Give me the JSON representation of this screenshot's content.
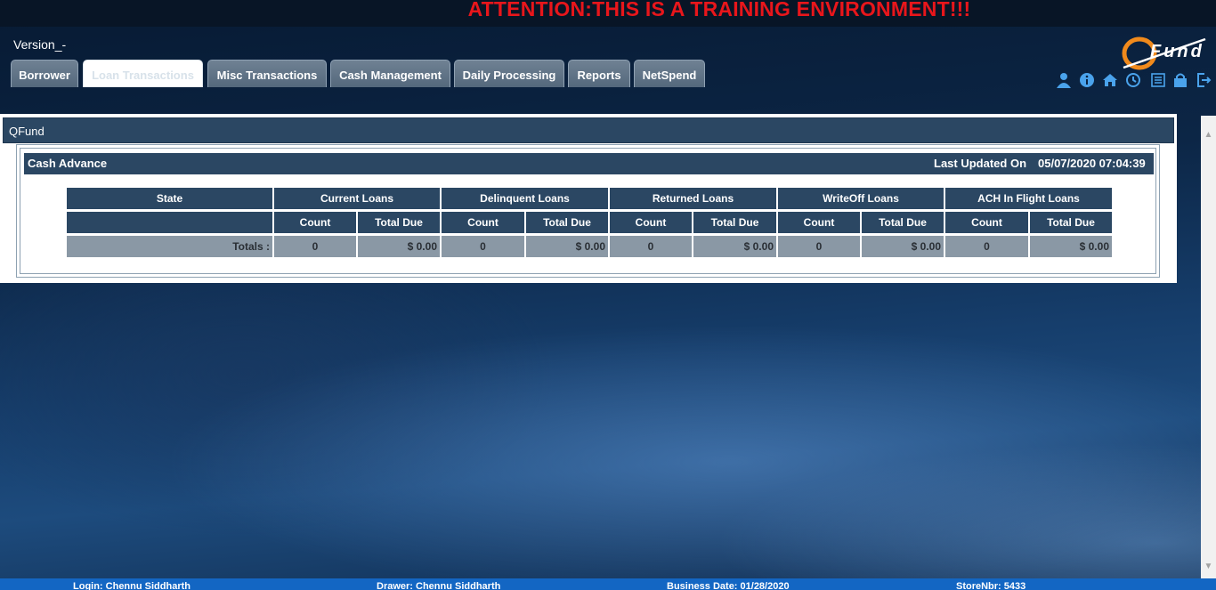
{
  "banner": "ATTENTION:THIS IS A TRAINING ENVIRONMENT!!!",
  "version": "Version_-",
  "logo": {
    "text": "Fund",
    "mark": "Q"
  },
  "tabs": [
    {
      "label": "Borrower",
      "active": false
    },
    {
      "label": "Loan Transactions",
      "active": true
    },
    {
      "label": "Misc Transactions",
      "active": false
    },
    {
      "label": "Cash Management",
      "active": false
    },
    {
      "label": "Daily Processing",
      "active": false
    },
    {
      "label": "Reports",
      "active": false
    },
    {
      "label": "NetSpend",
      "active": false
    }
  ],
  "toolbar_icons": [
    "user-icon",
    "info-icon",
    "home-icon",
    "clock-icon",
    "list-icon",
    "lock-icon",
    "logout-icon"
  ],
  "panel": {
    "title": "QFund",
    "section_title": "Cash Advance",
    "last_updated_label": "Last Updated On",
    "last_updated_value": "05/07/2020 07:04:39",
    "table": {
      "group_headers": [
        "State",
        "Current Loans",
        "Delinquent Loans",
        "Returned Loans",
        "WriteOff Loans",
        "ACH In Flight Loans"
      ],
      "sub_headers": [
        "Count",
        "Total Due",
        "Count",
        "Total Due",
        "Count",
        "Total Due",
        "Count",
        "Total Due",
        "Count",
        "Total Due"
      ],
      "totals_label": "Totals :",
      "totals": [
        "0",
        "$ 0.00",
        "0",
        "$ 0.00",
        "0",
        "$ 0.00",
        "0",
        "$ 0.00",
        "0",
        "$ 0.00"
      ]
    }
  },
  "status": {
    "login": "Login: Chennu Siddharth",
    "drawer": "Drawer: Chennu Siddharth",
    "business_date": "Business Date: 01/28/2020",
    "store": "StoreNbr: 5433"
  },
  "colors": {
    "banner": "#e8161b",
    "header_bg": "#2b4763",
    "tab_bg": "#5e7286",
    "icon": "#4aa3ec",
    "status_bar": "#1366c3"
  }
}
